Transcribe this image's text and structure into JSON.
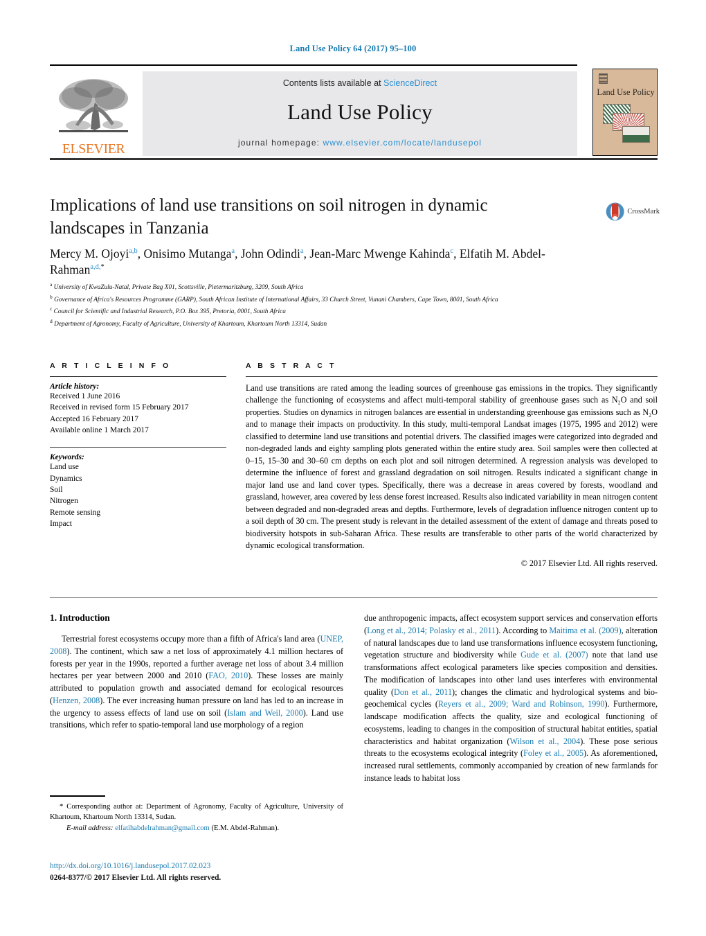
{
  "running_head": "Land Use Policy 64 (2017) 95–100",
  "masthead": {
    "contents_prefix": "Contents lists available at ",
    "sciencedirect": "ScienceDirect",
    "journal_title": "Land Use Policy",
    "homepage_prefix": "journal homepage: ",
    "homepage_url": "www.elsevier.com/locate/landusepol",
    "publisher": "ELSEVIER",
    "cover_title": "Land Use Policy",
    "link_color": "#2a8fd0",
    "publisher_color": "#E87722",
    "cover_bg": "#d8b99a"
  },
  "article": {
    "title": "Implications of land use transitions on soil nitrogen in dynamic landscapes in Tanzania",
    "crossmark_label": "CrossMark",
    "authors_html": "Mercy M. Ojoyi<sup>a,b</sup>, Onisimo Mutanga<sup>a</sup>, John Odindi<sup>a</sup>, Jean-Marc Mwenge Kahinda<sup>c</sup>, Elfatih M. Abdel-Rahman<sup>a,d,</sup><sup class=\"star\">*</sup>",
    "affiliations": [
      {
        "marker": "a",
        "text": "University of KwaZulu-Natal, Private Bag X01, Scottsville, Pietermaritzburg, 3209, South Africa"
      },
      {
        "marker": "b",
        "text": "Governance of Africa's Resources Programme (GARP), South African Institute of International Affairs, 33 Church Street, Vunani Chambers, Cape Town, 8001, South Africa"
      },
      {
        "marker": "c",
        "text": "Council for Scientific and Industrial Research, P.O. Box 395, Pretoria, 0001, South Africa"
      },
      {
        "marker": "d",
        "text": "Department of Agronomy, Faculty of Agriculture, University of Khartoum, Khartoum North 13314, Sudan"
      }
    ]
  },
  "article_info": {
    "heading": "A R T I C L E   I N F O",
    "history_label": "Article history:",
    "history": [
      "Received 1 June 2016",
      "Received in revised form 15 February 2017",
      "Accepted 16 February 2017",
      "Available online 1 March 2017"
    ],
    "keywords_label": "Keywords:",
    "keywords": [
      "Land use",
      "Dynamics",
      "Soil",
      "Nitrogen",
      "Remote sensing",
      "Impact"
    ]
  },
  "abstract": {
    "heading": "A B S T R A C T",
    "body": "Land use transitions are rated among the leading sources of greenhouse gas emissions in the tropics. They significantly challenge the functioning of ecosystems and affect multi-temporal stability of greenhouse gases such as N₂O and soil properties. Studies on dynamics in nitrogen balances are essential in understanding greenhouse gas emissions such as N₂O and to manage their impacts on productivity. In this study, multi-temporal Landsat images (1975, 1995 and 2012) were classified to determine land use transitions and potential drivers. The classified images were categorized into degraded and non-degraded lands and eighty sampling plots generated within the entire study area. Soil samples were then collected at 0–15, 15–30 and 30–60 cm depths on each plot and soil nitrogen determined. A regression analysis was developed to determine the influence of forest and grassland degradation on soil nitrogen. Results indicated a significant change in major land use and land cover types. Specifically, there was a decrease in areas covered by forests, woodland and grassland, however, area covered by less dense forest increased. Results also indicated variability in mean nitrogen content between degraded and non-degraded areas and depths. Furthermore, levels of degradation influence nitrogen content up to a soil depth of 30 cm. The present study is relevant in the detailed assessment of the extent of damage and threats posed to biodiversity hotspots in sub-Saharan Africa. These results are transferable to other parts of the world characterized by dynamic ecological transformation.",
    "copyright": "© 2017 Elsevier Ltd. All rights reserved."
  },
  "introduction": {
    "heading": "1.  Introduction",
    "left_paragraph_html": "Terrestrial forest ecosystems occupy more than a fifth of Africa's land area (<span class=\"ref\">UNEP, 2008</span>). The continent, which saw a net loss of approximately 4.1 million hectares of forests per year in the 1990s, reported a further average net loss of about 3.4 million hectares per year between 2000 and 2010 (<span class=\"ref\">FAO, 2010</span>). These losses are mainly attributed to population growth and associated demand for ecological resources (<span class=\"ref\">Henzen, 2008</span>). The ever increasing human pressure on land has led to an increase in the urgency to assess effects of land use on soil (<span class=\"ref\">Islam and Weil, 2000</span>). Land use transitions, which refer to spatio-temporal land use morphology of a region",
    "right_paragraph_html": "due anthropogenic impacts, affect ecosystem support services and conservation efforts (<span class=\"ref\">Long et al., 2014; Polasky et al., 2011</span>). According to <span class=\"ref\">Maitima et al. (2009)</span>, alteration of natural landscapes due to land use transformations influence ecosystem functioning, vegetation structure and biodiversity while <span class=\"ref\">Gude et al. (2007)</span> note that land use transformations affect ecological parameters like species composition and densities. The modification of landscapes into other land uses interferes with environmental quality (<span class=\"ref\">Don et al., 2011</span>); changes the climatic and hydrological systems and bio-geochemical cycles (<span class=\"ref\">Reyers et al., 2009; Ward and Robinson, 1990</span>). Furthermore, landscape modification affects the quality, size and ecological functioning of ecosystems, leading to changes in the composition of structural habitat entities, spatial characteristics and habitat organization (<span class=\"ref\">Wilson et al., 2004</span>). These pose serious threats to the ecosystems ecological integrity (<span class=\"ref\">Foley et al., 2005</span>). As aforementioned, increased rural settlements, commonly accompanied by creation of new farmlands for instance leads to habitat loss"
  },
  "footnotes": {
    "corresponding_html": "<span class=\"star\">*</span> Corresponding author at: Department of Agronomy, Faculty of Agriculture, University of Khartoum, Khartoum North 13314, Sudan.",
    "email_label": "E-mail address:",
    "email": "elfatihabdelrahman@gmail.com",
    "email_suffix": "(E.M. Abdel-Rahman)."
  },
  "doi_block": {
    "doi_url": "http://dx.doi.org/10.1016/j.landusepol.2017.02.023",
    "issn_line": "0264-8377/© 2017 Elsevier Ltd. All rights reserved."
  }
}
